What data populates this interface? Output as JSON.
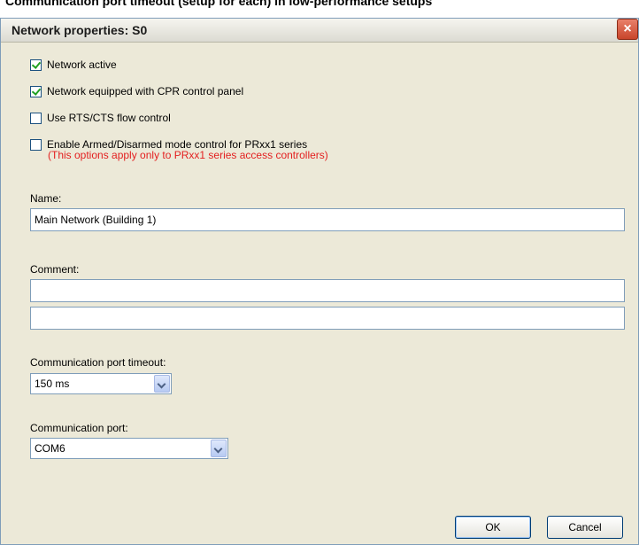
{
  "page_header": "Communication port timeout (setup for each) in low-performance setups",
  "window": {
    "title": "Network properties: S0",
    "close_symbol": "×"
  },
  "options": [
    {
      "label": "Network active",
      "checked": true
    },
    {
      "label": "Network equipped with CPR control panel",
      "checked": true
    },
    {
      "label": "Use RTS/CTS flow control",
      "checked": false
    },
    {
      "label": "Enable Armed/Disarmed mode control for PRxx1 series",
      "checked": false
    }
  ],
  "note": "(This options apply only to PRxx1 series access controllers)",
  "name": {
    "label": "Name:",
    "value": "Main Network (Building 1)"
  },
  "comment": {
    "label": "Comment:",
    "line1": "",
    "line2": ""
  },
  "timeout": {
    "label": "Communication port timeout:",
    "value": "150 ms"
  },
  "port": {
    "label": "Communication port:",
    "value": "COM6"
  },
  "buttons": {
    "ok": "OK",
    "cancel": "Cancel"
  },
  "colors": {
    "note": "#e31f1f",
    "window_bg": "#ece9d8",
    "close_button": "#c8452b"
  }
}
